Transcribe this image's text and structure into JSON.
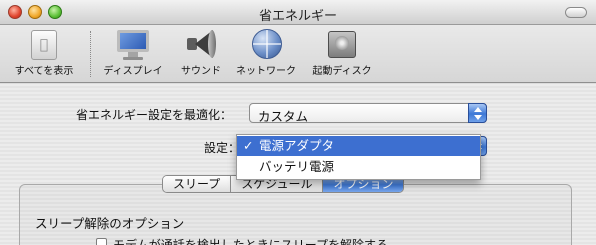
{
  "window": {
    "title": "省エネルギー"
  },
  "toolbar": {
    "items": [
      {
        "label": "すべてを表示",
        "icon": "apple-icon"
      },
      {
        "label": "ディスプレイ",
        "icon": "display-icon"
      },
      {
        "label": "サウンド",
        "icon": "speaker-icon"
      },
      {
        "label": "ネットワーク",
        "icon": "globe-icon"
      },
      {
        "label": "起動ディスク",
        "icon": "disk-icon"
      }
    ]
  },
  "optimize": {
    "label": "省エネルギー設定を最適化：",
    "value": "カスタム"
  },
  "settings": {
    "label": "設定：",
    "menu_items": [
      {
        "label": "電源アダプタ",
        "checked": true
      },
      {
        "label": "バッテリ電源",
        "checked": false
      }
    ]
  },
  "tabs": [
    {
      "label": "スリープ",
      "active": false
    },
    {
      "label": "スケジュール",
      "active": false
    },
    {
      "label": "オプション",
      "active": true
    }
  ],
  "options": {
    "section_title": "スリープ解除のオプション",
    "checkbox_label": "モデムが通話を検出したときにスリープを解除する"
  },
  "colors": {
    "accent": "#3d6fd0",
    "selection_text": "#ffffff"
  }
}
